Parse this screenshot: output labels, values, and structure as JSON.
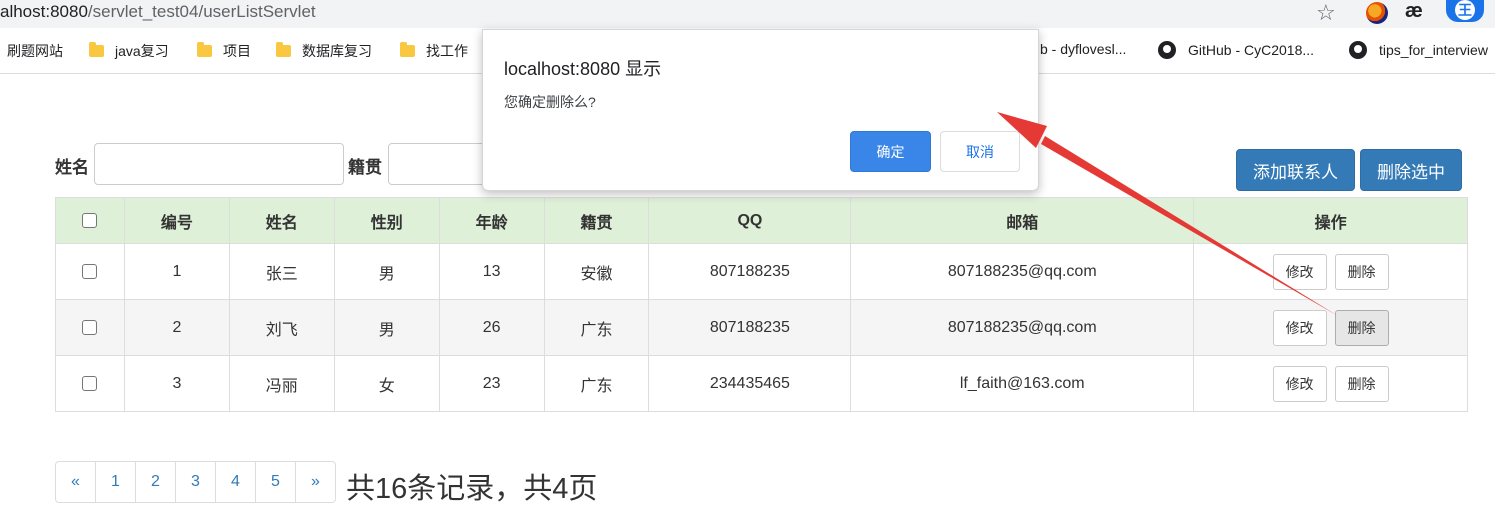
{
  "browser": {
    "url_host": "alhost:8080",
    "url_path": "/servlet_test04/userListServlet",
    "bookmarks": [
      {
        "label": "刷题网站",
        "icon": "none"
      },
      {
        "label": "java复习",
        "icon": "folder-icon"
      },
      {
        "label": "项目",
        "icon": "folder-icon"
      },
      {
        "label": "数据库复习",
        "icon": "folder-icon"
      },
      {
        "label": "找工作",
        "icon": "folder-icon"
      },
      {
        "label": "b - dyflovesl...",
        "icon": "none"
      },
      {
        "label": "GitHub - CyC2018...",
        "icon": "github-icon"
      },
      {
        "label": "tips_for_interview",
        "icon": "github-icon"
      }
    ],
    "star_glyph": "☆",
    "ext2_glyph": "æ",
    "ext3_glyph": "王"
  },
  "search": {
    "name_label": "姓名",
    "origin_label": "籍贯",
    "add_button": "添加联系人",
    "delete_selected_button": "删除选中"
  },
  "table": {
    "headers": [
      "编号",
      "姓名",
      "性别",
      "年龄",
      "籍贯",
      "QQ",
      "邮箱",
      "操作"
    ],
    "rows": [
      {
        "id": "1",
        "name": "张三",
        "gender": "男",
        "age": "13",
        "origin": "安徽",
        "qq": "807188235",
        "email": "807188235@qq.com"
      },
      {
        "id": "2",
        "name": "刘飞",
        "gender": "男",
        "age": "26",
        "origin": "广东",
        "qq": "807188235",
        "email": "807188235@qq.com"
      },
      {
        "id": "3",
        "name": "冯丽",
        "gender": "女",
        "age": "23",
        "origin": "广东",
        "qq": "234435465",
        "email": "lf_faith@163.com"
      }
    ],
    "edit_label": "修改",
    "delete_label": "删除"
  },
  "pagination": {
    "prev": "«",
    "pages": [
      "1",
      "2",
      "3",
      "4",
      "5"
    ],
    "next": "»",
    "summary": "共16条记录，共4页"
  },
  "dialog": {
    "title": "localhost:8080 显示",
    "message": "您确定删除么?",
    "ok": "确定",
    "cancel": "取消"
  },
  "colors": {
    "primary": "#337ab7",
    "header_bg": "#dff0d8",
    "dialog_ok": "#3a86e8",
    "annotation_arrow": "#e53935"
  }
}
